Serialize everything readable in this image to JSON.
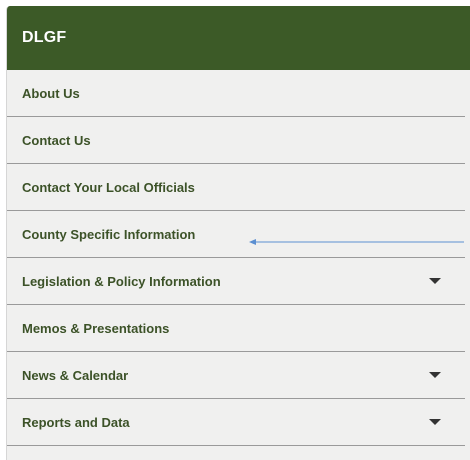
{
  "header": {
    "title": "DLGF"
  },
  "nav": {
    "items": [
      {
        "label": "About Us",
        "has_dropdown": false
      },
      {
        "label": "Contact Us",
        "has_dropdown": false
      },
      {
        "label": "Contact Your Local Officials",
        "has_dropdown": false
      },
      {
        "label": "County Specific Information",
        "has_dropdown": false
      },
      {
        "label": "Legislation & Policy Information",
        "has_dropdown": true
      },
      {
        "label": "Memos & Presentations",
        "has_dropdown": false
      },
      {
        "label": "News & Calendar",
        "has_dropdown": true
      },
      {
        "label": "Reports and Data",
        "has_dropdown": true
      }
    ]
  },
  "annotation": {
    "icon": "arrow-left-icon",
    "color": "#5b8fd1",
    "points_to": "County Specific Information"
  },
  "colors": {
    "header_bg": "#3c5a27",
    "header_text": "#ffffff",
    "item_text": "#3c5228",
    "panel_bg": "#f0f0ef",
    "divider": "#9a9a9a"
  }
}
